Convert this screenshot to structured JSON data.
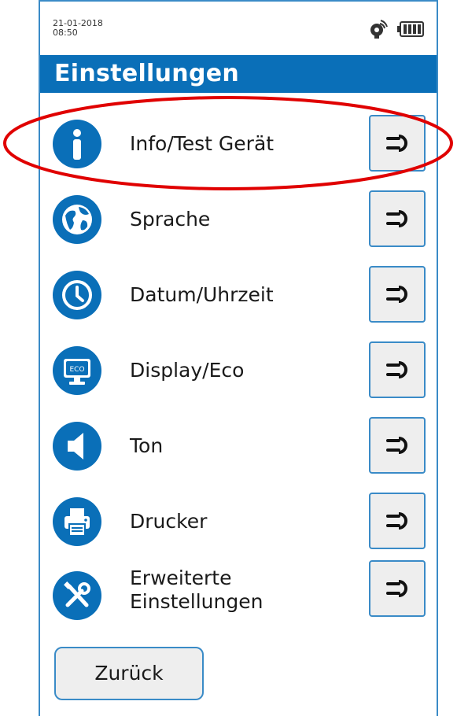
{
  "status": {
    "date": "21-01-2018",
    "time": "08:50",
    "icons": [
      "antenna-icon",
      "battery-icon"
    ]
  },
  "header": {
    "title": "Einstellungen"
  },
  "menu": {
    "items": [
      {
        "label": "Info/Test Gerät",
        "icon": "info-icon"
      },
      {
        "label": "Sprache",
        "icon": "globe-icon"
      },
      {
        "label": "Datum/Uhrzeit",
        "icon": "clock-icon"
      },
      {
        "label": "Display/Eco",
        "icon": "display-eco-icon",
        "icon_text": "ECO"
      },
      {
        "label": "Ton",
        "icon": "speaker-icon"
      },
      {
        "label": "Drucker",
        "icon": "printer-icon"
      },
      {
        "label_line1": "Erweiterte",
        "label_line2": "Einstellungen",
        "icon": "tools-icon"
      }
    ],
    "button_icon": "arrow-right-icon"
  },
  "footer": {
    "back_label": "Zurück"
  },
  "colors": {
    "brand_blue": "#0a6fb8",
    "button_border": "#3a8bc7",
    "button_bg": "#eeeeee",
    "highlight": "#e00000"
  }
}
